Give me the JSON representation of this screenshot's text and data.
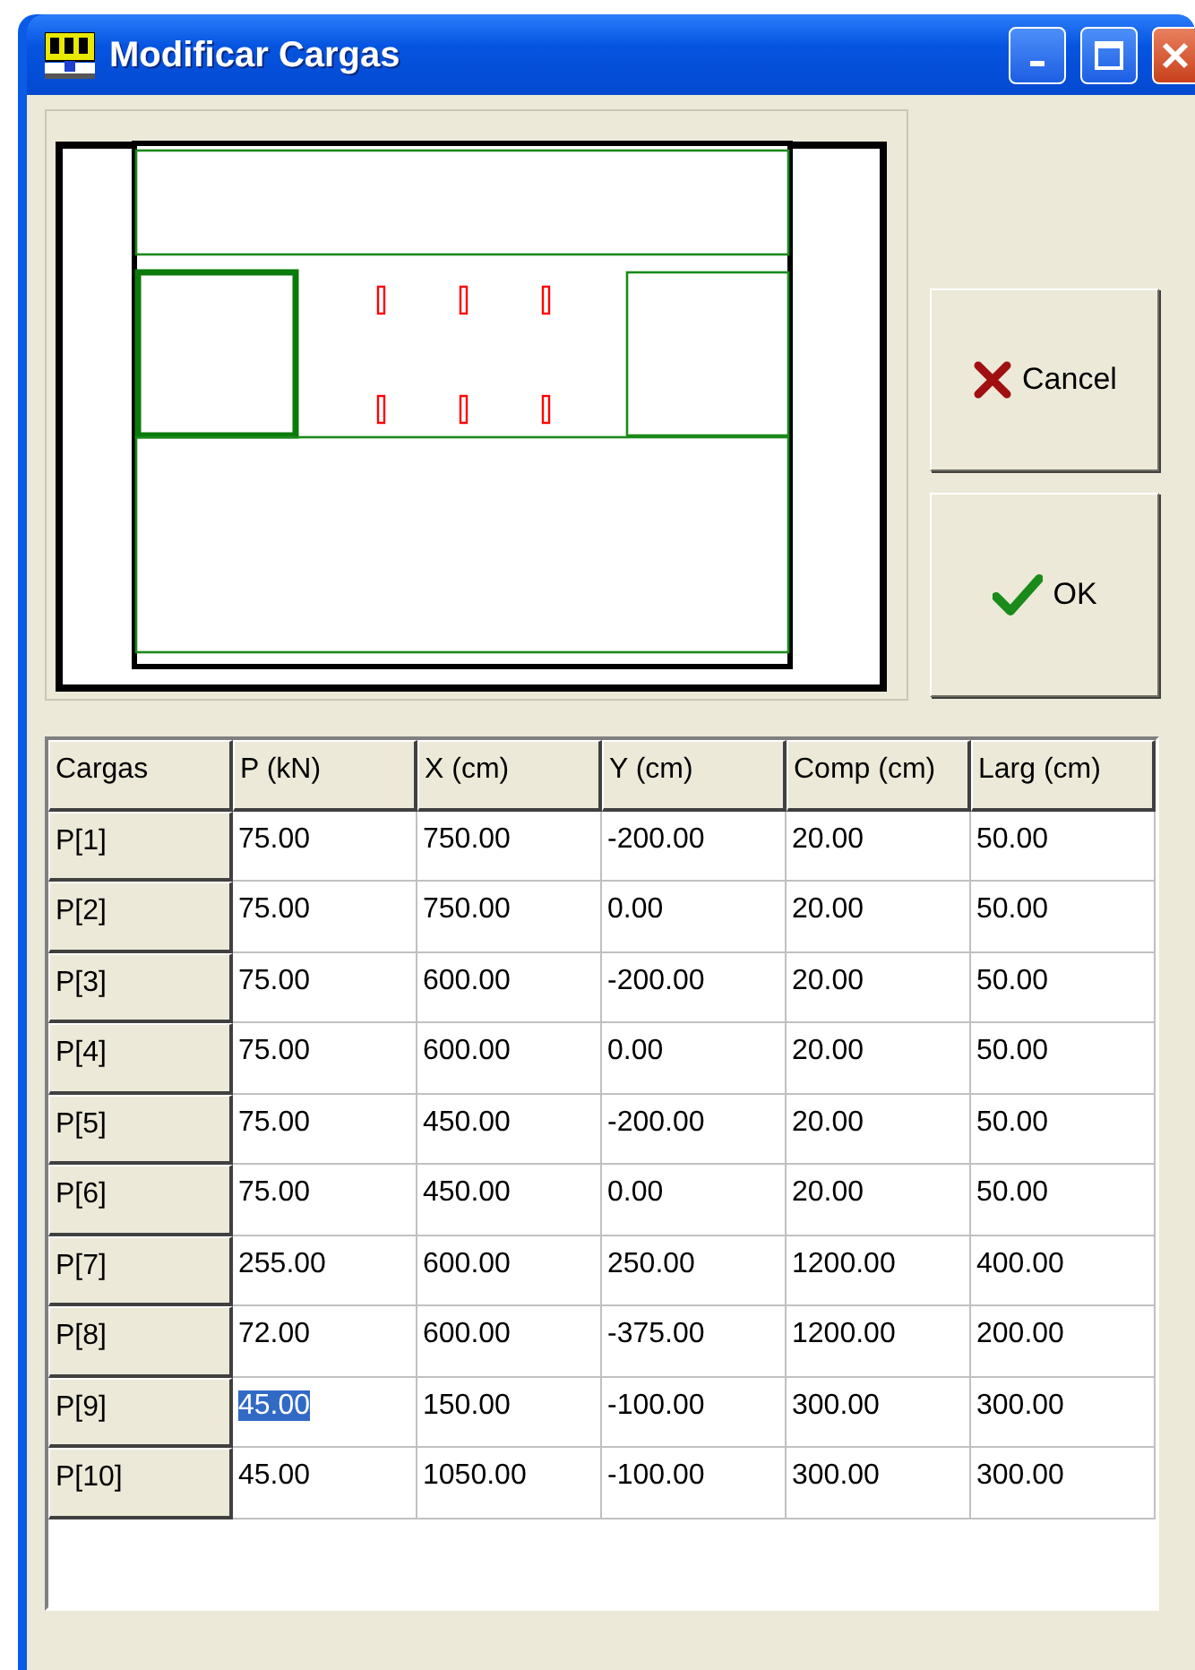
{
  "window": {
    "title": "Modificar Cargas"
  },
  "buttons": [
    {
      "kind": "cancel",
      "label": "Cancel"
    },
    {
      "kind": "ok",
      "label": "OK"
    }
  ],
  "table": {
    "columns": [
      "Cargas",
      "P (kN)",
      "X (cm)",
      "Y (cm)",
      "Comp (cm)",
      "Larg (cm)"
    ],
    "rows": [
      {
        "cells": [
          {
            "kind": "header",
            "text": "P[1]",
            "selected": false
          },
          {
            "kind": "value",
            "text": "75.00",
            "selected": false
          },
          {
            "kind": "value",
            "text": "750.00",
            "selected": false
          },
          {
            "kind": "value",
            "text": "-200.00",
            "selected": false
          },
          {
            "kind": "value",
            "text": "20.00",
            "selected": false
          },
          {
            "kind": "value",
            "text": "50.00",
            "selected": false
          }
        ]
      },
      {
        "cells": [
          {
            "kind": "header",
            "text": "P[2]",
            "selected": false
          },
          {
            "kind": "value",
            "text": "75.00",
            "selected": false
          },
          {
            "kind": "value",
            "text": "750.00",
            "selected": false
          },
          {
            "kind": "value",
            "text": "0.00",
            "selected": false
          },
          {
            "kind": "value",
            "text": "20.00",
            "selected": false
          },
          {
            "kind": "value",
            "text": "50.00",
            "selected": false
          }
        ]
      },
      {
        "cells": [
          {
            "kind": "header",
            "text": "P[3]",
            "selected": false
          },
          {
            "kind": "value",
            "text": "75.00",
            "selected": false
          },
          {
            "kind": "value",
            "text": "600.00",
            "selected": false
          },
          {
            "kind": "value",
            "text": "-200.00",
            "selected": false
          },
          {
            "kind": "value",
            "text": "20.00",
            "selected": false
          },
          {
            "kind": "value",
            "text": "50.00",
            "selected": false
          }
        ]
      },
      {
        "cells": [
          {
            "kind": "header",
            "text": "P[4]",
            "selected": false
          },
          {
            "kind": "value",
            "text": "75.00",
            "selected": false
          },
          {
            "kind": "value",
            "text": "600.00",
            "selected": false
          },
          {
            "kind": "value",
            "text": "0.00",
            "selected": false
          },
          {
            "kind": "value",
            "text": "20.00",
            "selected": false
          },
          {
            "kind": "value",
            "text": "50.00",
            "selected": false
          }
        ]
      },
      {
        "cells": [
          {
            "kind": "header",
            "text": "P[5]",
            "selected": false
          },
          {
            "kind": "value",
            "text": "75.00",
            "selected": false
          },
          {
            "kind": "value",
            "text": "450.00",
            "selected": false
          },
          {
            "kind": "value",
            "text": "-200.00",
            "selected": false
          },
          {
            "kind": "value",
            "text": "20.00",
            "selected": false
          },
          {
            "kind": "value",
            "text": "50.00",
            "selected": false
          }
        ]
      },
      {
        "cells": [
          {
            "kind": "header",
            "text": "P[6]",
            "selected": false
          },
          {
            "kind": "value",
            "text": "75.00",
            "selected": false
          },
          {
            "kind": "value",
            "text": "450.00",
            "selected": false
          },
          {
            "kind": "value",
            "text": "0.00",
            "selected": false
          },
          {
            "kind": "value",
            "text": "20.00",
            "selected": false
          },
          {
            "kind": "value",
            "text": "50.00",
            "selected": false
          }
        ]
      },
      {
        "cells": [
          {
            "kind": "header",
            "text": "P[7]",
            "selected": false
          },
          {
            "kind": "value",
            "text": "255.00",
            "selected": false
          },
          {
            "kind": "value",
            "text": "600.00",
            "selected": false
          },
          {
            "kind": "value",
            "text": "250.00",
            "selected": false
          },
          {
            "kind": "value",
            "text": "1200.00",
            "selected": false
          },
          {
            "kind": "value",
            "text": "400.00",
            "selected": false
          }
        ]
      },
      {
        "cells": [
          {
            "kind": "header",
            "text": "P[8]",
            "selected": false
          },
          {
            "kind": "value",
            "text": "72.00",
            "selected": false
          },
          {
            "kind": "value",
            "text": "600.00",
            "selected": false
          },
          {
            "kind": "value",
            "text": "-375.00",
            "selected": false
          },
          {
            "kind": "value",
            "text": "1200.00",
            "selected": false
          },
          {
            "kind": "value",
            "text": "200.00",
            "selected": false
          }
        ]
      },
      {
        "cells": [
          {
            "kind": "header",
            "text": "P[9]",
            "selected": false
          },
          {
            "kind": "value",
            "text": "45.00",
            "selected": true
          },
          {
            "kind": "value",
            "text": "150.00",
            "selected": false
          },
          {
            "kind": "value",
            "text": "-100.00",
            "selected": false
          },
          {
            "kind": "value",
            "text": "300.00",
            "selected": false
          },
          {
            "kind": "value",
            "text": "300.00",
            "selected": false
          }
        ]
      },
      {
        "cells": [
          {
            "kind": "header",
            "text": "P[10]",
            "selected": false
          },
          {
            "kind": "value",
            "text": "45.00",
            "selected": false
          },
          {
            "kind": "value",
            "text": "1050.00",
            "selected": false
          },
          {
            "kind": "value",
            "text": "-100.00",
            "selected": false
          },
          {
            "kind": "value",
            "text": "300.00",
            "selected": false
          },
          {
            "kind": "value",
            "text": "300.00",
            "selected": false
          }
        ]
      }
    ]
  }
}
